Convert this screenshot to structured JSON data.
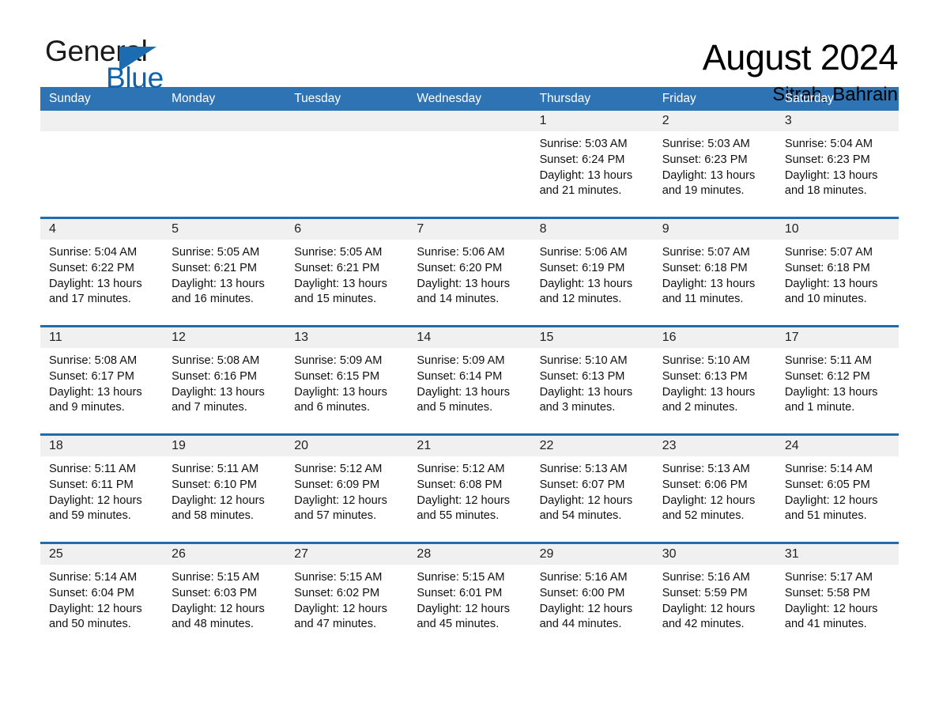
{
  "brand": {
    "name_part1": "General",
    "name_part2": "Blue",
    "triangle_color": "#1b6cb0",
    "blue_color": "#0f62ad"
  },
  "header": {
    "month_title": "August 2024",
    "location": "Sitrah, Bahrain"
  },
  "theme": {
    "header_bar_color": "#2e74b5",
    "week_divider_color": "#1f6cae",
    "daynum_band_color": "#f0f0f0",
    "text_color": "#111111"
  },
  "weekday_headers": [
    "Sunday",
    "Monday",
    "Tuesday",
    "Wednesday",
    "Thursday",
    "Friday",
    "Saturday"
  ],
  "weeks": [
    {
      "days": [
        {
          "num": "",
          "empty": true,
          "sunrise": "",
          "sunset": "",
          "daylight_line1": "",
          "daylight_line2": ""
        },
        {
          "num": "",
          "empty": true,
          "sunrise": "",
          "sunset": "",
          "daylight_line1": "",
          "daylight_line2": ""
        },
        {
          "num": "",
          "empty": true,
          "sunrise": "",
          "sunset": "",
          "daylight_line1": "",
          "daylight_line2": ""
        },
        {
          "num": "",
          "empty": true,
          "sunrise": "",
          "sunset": "",
          "daylight_line1": "",
          "daylight_line2": ""
        },
        {
          "num": "1",
          "empty": false,
          "sunrise": "Sunrise: 5:03 AM",
          "sunset": "Sunset: 6:24 PM",
          "daylight_line1": "Daylight: 13 hours",
          "daylight_line2": "and 21 minutes."
        },
        {
          "num": "2",
          "empty": false,
          "sunrise": "Sunrise: 5:03 AM",
          "sunset": "Sunset: 6:23 PM",
          "daylight_line1": "Daylight: 13 hours",
          "daylight_line2": "and 19 minutes."
        },
        {
          "num": "3",
          "empty": false,
          "sunrise": "Sunrise: 5:04 AM",
          "sunset": "Sunset: 6:23 PM",
          "daylight_line1": "Daylight: 13 hours",
          "daylight_line2": "and 18 minutes."
        }
      ]
    },
    {
      "days": [
        {
          "num": "4",
          "empty": false,
          "sunrise": "Sunrise: 5:04 AM",
          "sunset": "Sunset: 6:22 PM",
          "daylight_line1": "Daylight: 13 hours",
          "daylight_line2": "and 17 minutes."
        },
        {
          "num": "5",
          "empty": false,
          "sunrise": "Sunrise: 5:05 AM",
          "sunset": "Sunset: 6:21 PM",
          "daylight_line1": "Daylight: 13 hours",
          "daylight_line2": "and 16 minutes."
        },
        {
          "num": "6",
          "empty": false,
          "sunrise": "Sunrise: 5:05 AM",
          "sunset": "Sunset: 6:21 PM",
          "daylight_line1": "Daylight: 13 hours",
          "daylight_line2": "and 15 minutes."
        },
        {
          "num": "7",
          "empty": false,
          "sunrise": "Sunrise: 5:06 AM",
          "sunset": "Sunset: 6:20 PM",
          "daylight_line1": "Daylight: 13 hours",
          "daylight_line2": "and 14 minutes."
        },
        {
          "num": "8",
          "empty": false,
          "sunrise": "Sunrise: 5:06 AM",
          "sunset": "Sunset: 6:19 PM",
          "daylight_line1": "Daylight: 13 hours",
          "daylight_line2": "and 12 minutes."
        },
        {
          "num": "9",
          "empty": false,
          "sunrise": "Sunrise: 5:07 AM",
          "sunset": "Sunset: 6:18 PM",
          "daylight_line1": "Daylight: 13 hours",
          "daylight_line2": "and 11 minutes."
        },
        {
          "num": "10",
          "empty": false,
          "sunrise": "Sunrise: 5:07 AM",
          "sunset": "Sunset: 6:18 PM",
          "daylight_line1": "Daylight: 13 hours",
          "daylight_line2": "and 10 minutes."
        }
      ]
    },
    {
      "days": [
        {
          "num": "11",
          "empty": false,
          "sunrise": "Sunrise: 5:08 AM",
          "sunset": "Sunset: 6:17 PM",
          "daylight_line1": "Daylight: 13 hours",
          "daylight_line2": "and 9 minutes."
        },
        {
          "num": "12",
          "empty": false,
          "sunrise": "Sunrise: 5:08 AM",
          "sunset": "Sunset: 6:16 PM",
          "daylight_line1": "Daylight: 13 hours",
          "daylight_line2": "and 7 minutes."
        },
        {
          "num": "13",
          "empty": false,
          "sunrise": "Sunrise: 5:09 AM",
          "sunset": "Sunset: 6:15 PM",
          "daylight_line1": "Daylight: 13 hours",
          "daylight_line2": "and 6 minutes."
        },
        {
          "num": "14",
          "empty": false,
          "sunrise": "Sunrise: 5:09 AM",
          "sunset": "Sunset: 6:14 PM",
          "daylight_line1": "Daylight: 13 hours",
          "daylight_line2": "and 5 minutes."
        },
        {
          "num": "15",
          "empty": false,
          "sunrise": "Sunrise: 5:10 AM",
          "sunset": "Sunset: 6:13 PM",
          "daylight_line1": "Daylight: 13 hours",
          "daylight_line2": "and 3 minutes."
        },
        {
          "num": "16",
          "empty": false,
          "sunrise": "Sunrise: 5:10 AM",
          "sunset": "Sunset: 6:13 PM",
          "daylight_line1": "Daylight: 13 hours",
          "daylight_line2": "and 2 minutes."
        },
        {
          "num": "17",
          "empty": false,
          "sunrise": "Sunrise: 5:11 AM",
          "sunset": "Sunset: 6:12 PM",
          "daylight_line1": "Daylight: 13 hours",
          "daylight_line2": "and 1 minute."
        }
      ]
    },
    {
      "days": [
        {
          "num": "18",
          "empty": false,
          "sunrise": "Sunrise: 5:11 AM",
          "sunset": "Sunset: 6:11 PM",
          "daylight_line1": "Daylight: 12 hours",
          "daylight_line2": "and 59 minutes."
        },
        {
          "num": "19",
          "empty": false,
          "sunrise": "Sunrise: 5:11 AM",
          "sunset": "Sunset: 6:10 PM",
          "daylight_line1": "Daylight: 12 hours",
          "daylight_line2": "and 58 minutes."
        },
        {
          "num": "20",
          "empty": false,
          "sunrise": "Sunrise: 5:12 AM",
          "sunset": "Sunset: 6:09 PM",
          "daylight_line1": "Daylight: 12 hours",
          "daylight_line2": "and 57 minutes."
        },
        {
          "num": "21",
          "empty": false,
          "sunrise": "Sunrise: 5:12 AM",
          "sunset": "Sunset: 6:08 PM",
          "daylight_line1": "Daylight: 12 hours",
          "daylight_line2": "and 55 minutes."
        },
        {
          "num": "22",
          "empty": false,
          "sunrise": "Sunrise: 5:13 AM",
          "sunset": "Sunset: 6:07 PM",
          "daylight_line1": "Daylight: 12 hours",
          "daylight_line2": "and 54 minutes."
        },
        {
          "num": "23",
          "empty": false,
          "sunrise": "Sunrise: 5:13 AM",
          "sunset": "Sunset: 6:06 PM",
          "daylight_line1": "Daylight: 12 hours",
          "daylight_line2": "and 52 minutes."
        },
        {
          "num": "24",
          "empty": false,
          "sunrise": "Sunrise: 5:14 AM",
          "sunset": "Sunset: 6:05 PM",
          "daylight_line1": "Daylight: 12 hours",
          "daylight_line2": "and 51 minutes."
        }
      ]
    },
    {
      "days": [
        {
          "num": "25",
          "empty": false,
          "sunrise": "Sunrise: 5:14 AM",
          "sunset": "Sunset: 6:04 PM",
          "daylight_line1": "Daylight: 12 hours",
          "daylight_line2": "and 50 minutes."
        },
        {
          "num": "26",
          "empty": false,
          "sunrise": "Sunrise: 5:15 AM",
          "sunset": "Sunset: 6:03 PM",
          "daylight_line1": "Daylight: 12 hours",
          "daylight_line2": "and 48 minutes."
        },
        {
          "num": "27",
          "empty": false,
          "sunrise": "Sunrise: 5:15 AM",
          "sunset": "Sunset: 6:02 PM",
          "daylight_line1": "Daylight: 12 hours",
          "daylight_line2": "and 47 minutes."
        },
        {
          "num": "28",
          "empty": false,
          "sunrise": "Sunrise: 5:15 AM",
          "sunset": "Sunset: 6:01 PM",
          "daylight_line1": "Daylight: 12 hours",
          "daylight_line2": "and 45 minutes."
        },
        {
          "num": "29",
          "empty": false,
          "sunrise": "Sunrise: 5:16 AM",
          "sunset": "Sunset: 6:00 PM",
          "daylight_line1": "Daylight: 12 hours",
          "daylight_line2": "and 44 minutes."
        },
        {
          "num": "30",
          "empty": false,
          "sunrise": "Sunrise: 5:16 AM",
          "sunset": "Sunset: 5:59 PM",
          "daylight_line1": "Daylight: 12 hours",
          "daylight_line2": "and 42 minutes."
        },
        {
          "num": "31",
          "empty": false,
          "sunrise": "Sunrise: 5:17 AM",
          "sunset": "Sunset: 5:58 PM",
          "daylight_line1": "Daylight: 12 hours",
          "daylight_line2": "and 41 minutes."
        }
      ]
    }
  ]
}
